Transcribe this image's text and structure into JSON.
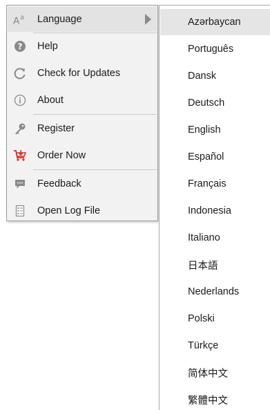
{
  "menu": {
    "items": [
      {
        "label": "Language",
        "icon": "font-size-icon",
        "has_submenu": true
      },
      {
        "label": "Help",
        "icon": "question-circle-icon"
      },
      {
        "label": "Check for Updates",
        "icon": "refresh-icon"
      },
      {
        "label": "About",
        "icon": "info-circle-icon"
      },
      {
        "label": "Register",
        "icon": "key-icon"
      },
      {
        "label": "Order Now",
        "icon": "cart-icon"
      },
      {
        "label": "Feedback",
        "icon": "speech-bubble-icon"
      },
      {
        "label": "Open Log File",
        "icon": "log-file-icon"
      }
    ]
  },
  "submenu": {
    "selected": "Azərbaycan",
    "languages": [
      "Azərbaycan",
      "Português",
      "Dansk",
      "Deutsch",
      "English",
      "Español",
      "Français",
      "Indonesia",
      "Italiano",
      "日本語",
      "Nederlands",
      "Polski",
      "Türkçe",
      "简体中文",
      "繁體中文"
    ]
  },
  "colors": {
    "icon_gray": "#8a8a8a",
    "cart_red": "#d92a2a",
    "menu_bg": "#f2f2f2",
    "highlight": "#e3e3e3"
  }
}
